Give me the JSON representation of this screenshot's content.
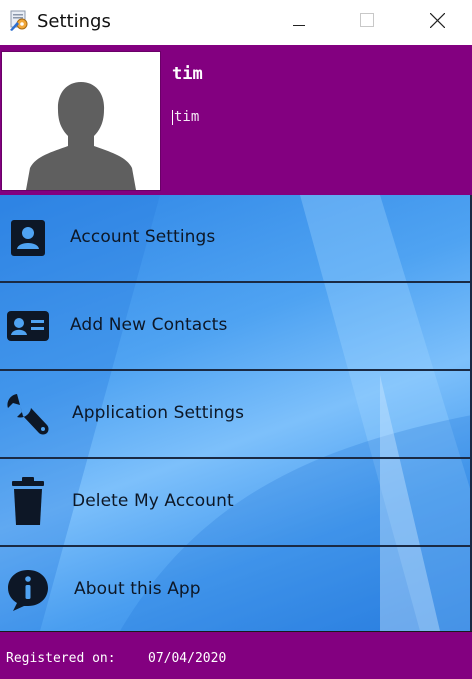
{
  "window": {
    "title": "Settings",
    "icons": {
      "app": "settings-app-icon",
      "minimize": "minimize-icon",
      "maximize": "maximize-icon",
      "close": "close-icon"
    }
  },
  "profile": {
    "name": "tim",
    "input_value": "tim",
    "avatar_icon": "user-silhouette-icon"
  },
  "menu": {
    "items": [
      {
        "label": "Account Settings",
        "icon": "user-card-icon"
      },
      {
        "label": "Add New Contacts",
        "icon": "contact-card-icon"
      },
      {
        "label": "Application Settings",
        "icon": "wrench-icon"
      },
      {
        "label": "Delete My Account",
        "icon": "trash-icon"
      },
      {
        "label": "About this App",
        "icon": "info-bubble-icon"
      }
    ]
  },
  "footer": {
    "registered_label": "Registered on:",
    "registered_date": "07/04/2020"
  },
  "colors": {
    "header": "#830080",
    "footer": "#830080",
    "menu_blue": "#4fa3f2",
    "divider": "#1a2a44"
  }
}
